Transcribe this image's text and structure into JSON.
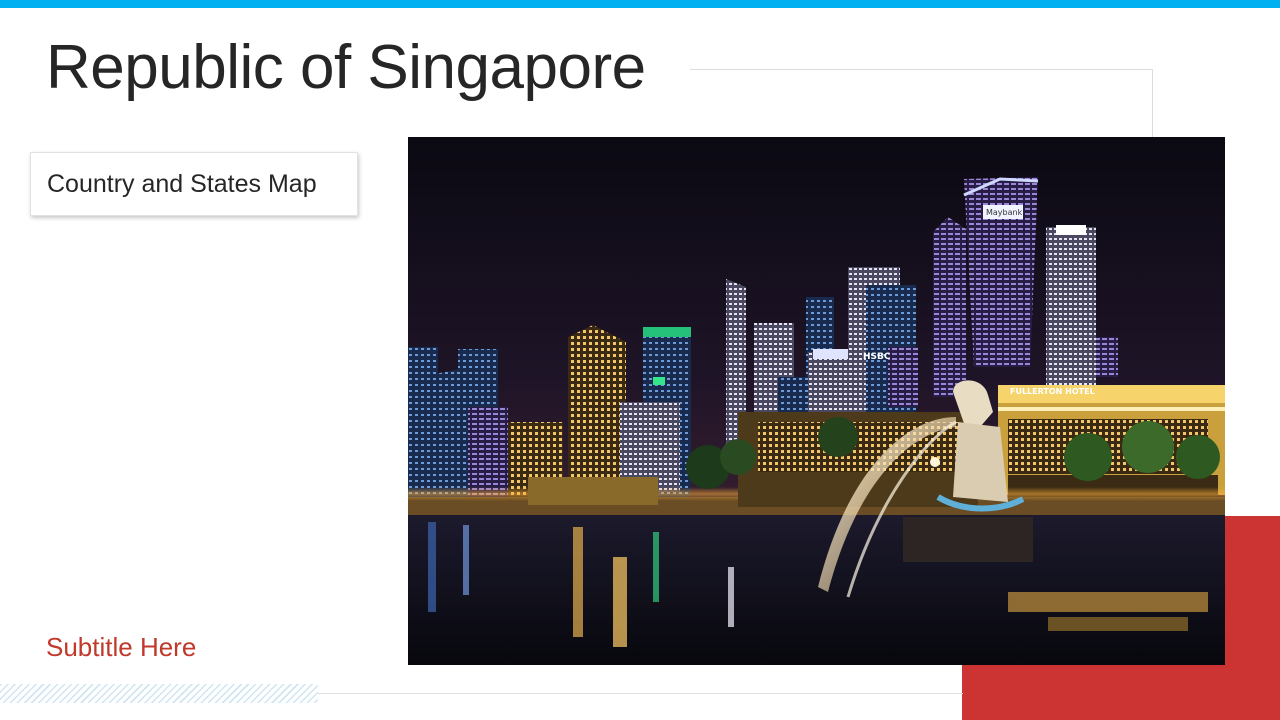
{
  "slide": {
    "title": "Republic of Singapore",
    "label_box": "Country and States Map",
    "subtitle": "Subtitle Here"
  },
  "photo": {
    "subject": "Singapore skyline at night with Merlion statue and Marina Bay waterfront",
    "signs": [
      "HSBC",
      "FULLERTON HOTEL",
      "Maybank"
    ]
  },
  "colors": {
    "accent_blue": "#00b0f0",
    "accent_red": "#cc3333",
    "subtitle_red": "#c0392b",
    "title_text": "#262626"
  }
}
